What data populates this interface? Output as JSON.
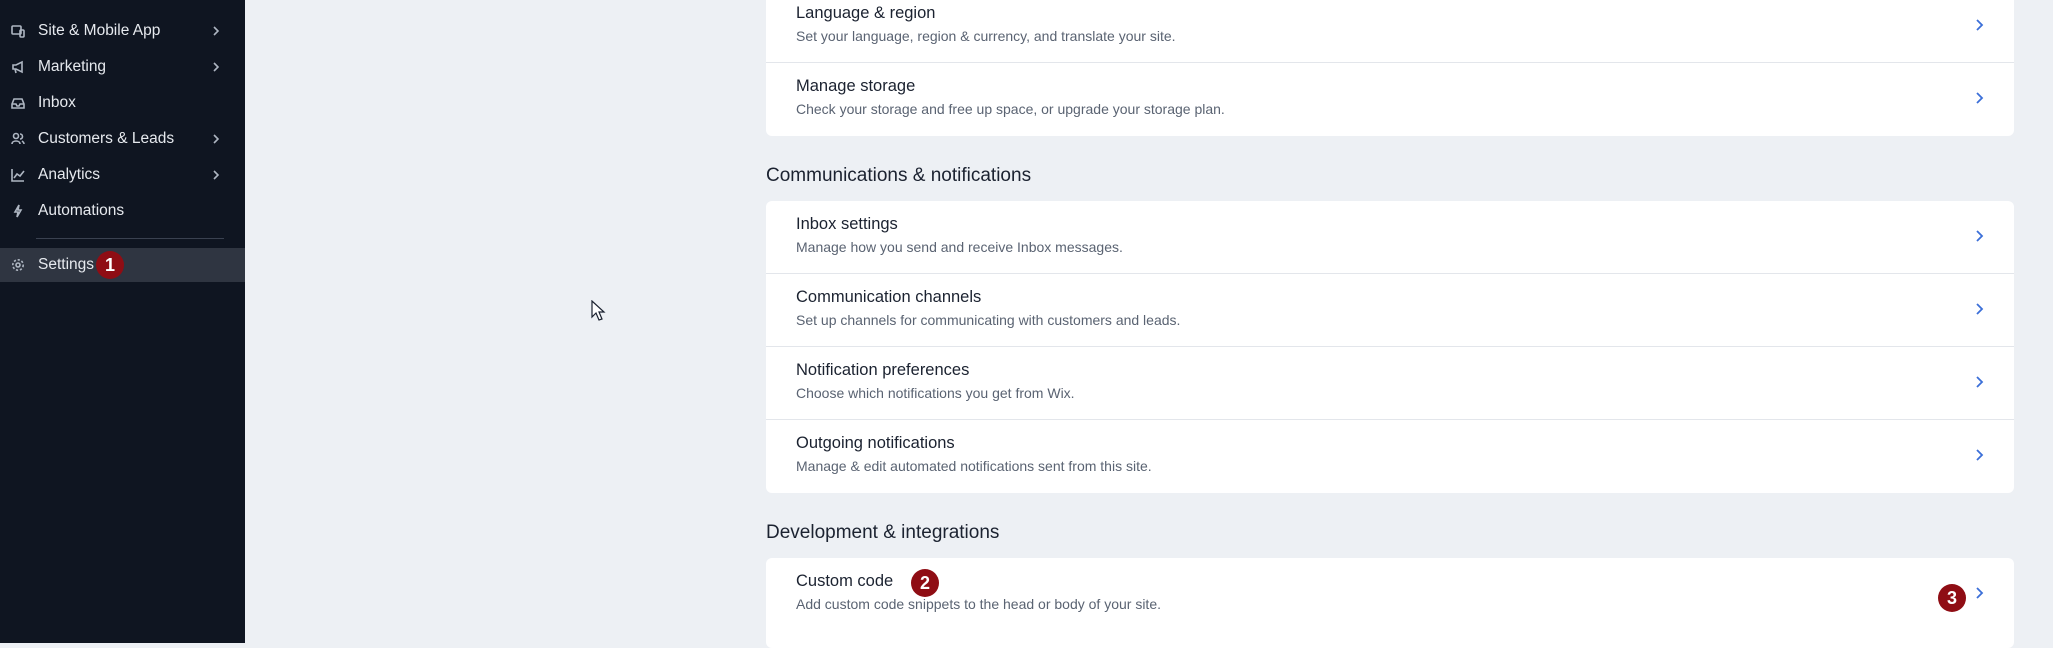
{
  "sidebar": {
    "items": [
      {
        "label": "Site & Mobile App",
        "icon": "site-icon",
        "has_submenu": true
      },
      {
        "label": "Marketing",
        "icon": "megaphone-icon",
        "has_submenu": true
      },
      {
        "label": "Inbox",
        "icon": "inbox-icon",
        "has_submenu": false
      },
      {
        "label": "Customers & Leads",
        "icon": "customers-icon",
        "has_submenu": true
      },
      {
        "label": "Analytics",
        "icon": "analytics-icon",
        "has_submenu": true
      },
      {
        "label": "Automations",
        "icon": "automations-icon",
        "has_submenu": false
      }
    ],
    "settings": {
      "label": "Settings",
      "icon": "gear-icon"
    }
  },
  "badges": {
    "one": "1",
    "two": "2",
    "three": "3"
  },
  "sections": {
    "top_card": [
      {
        "title": "Language & region",
        "desc": "Set your language, region & currency, and translate your site."
      },
      {
        "title": "Manage storage",
        "desc": "Check your storage and free up space, or upgrade your storage plan."
      }
    ],
    "communications": {
      "heading": "Communications & notifications",
      "rows": [
        {
          "title": "Inbox settings",
          "desc": "Manage how you send and receive Inbox messages."
        },
        {
          "title": "Communication channels",
          "desc": "Set up channels for communicating with customers and leads."
        },
        {
          "title": "Notification preferences",
          "desc": "Choose which notifications you get from Wix."
        },
        {
          "title": "Outgoing notifications",
          "desc": "Manage & edit automated notifications sent from this site."
        }
      ]
    },
    "development": {
      "heading": "Development & integrations",
      "rows": [
        {
          "title": "Custom code",
          "desc": "Add custom code snippets to the head or body of your site."
        }
      ]
    }
  },
  "colors": {
    "sidebar_bg": "#0f1521",
    "active_bg": "#2f3541",
    "badge": "#8f0d14",
    "chevron": "#3b6fd8",
    "page_bg": "#edf0f4"
  }
}
